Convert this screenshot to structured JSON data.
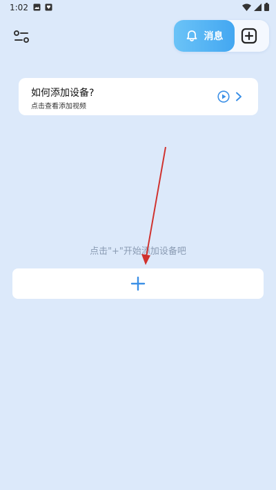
{
  "status_bar": {
    "time": "1:02",
    "left_icons": [
      "image-icon",
      "notification-icon"
    ],
    "right_icons": [
      "wifi-icon",
      "signal-icon",
      "battery-icon"
    ]
  },
  "header": {
    "filter_icon": "sliders-icon",
    "message_label": "消息",
    "message_icon": "bell-icon",
    "add_icon": "plus-square-icon"
  },
  "guide_card": {
    "title": "如何添加设备?",
    "subtitle": "点击查看添加视频",
    "play_icon": "play-circle-icon",
    "chevron_icon": "chevron-right-icon"
  },
  "empty_state": {
    "hint": "点击\"+\"开始添加设备吧",
    "add_icon": "plus-icon"
  },
  "colors": {
    "background": "#dce9fa",
    "accent": "#3a8fe6",
    "message_gradient_start": "#6bc3f7",
    "message_gradient_end": "#43a7f1",
    "annotation_arrow": "#d0312d"
  }
}
